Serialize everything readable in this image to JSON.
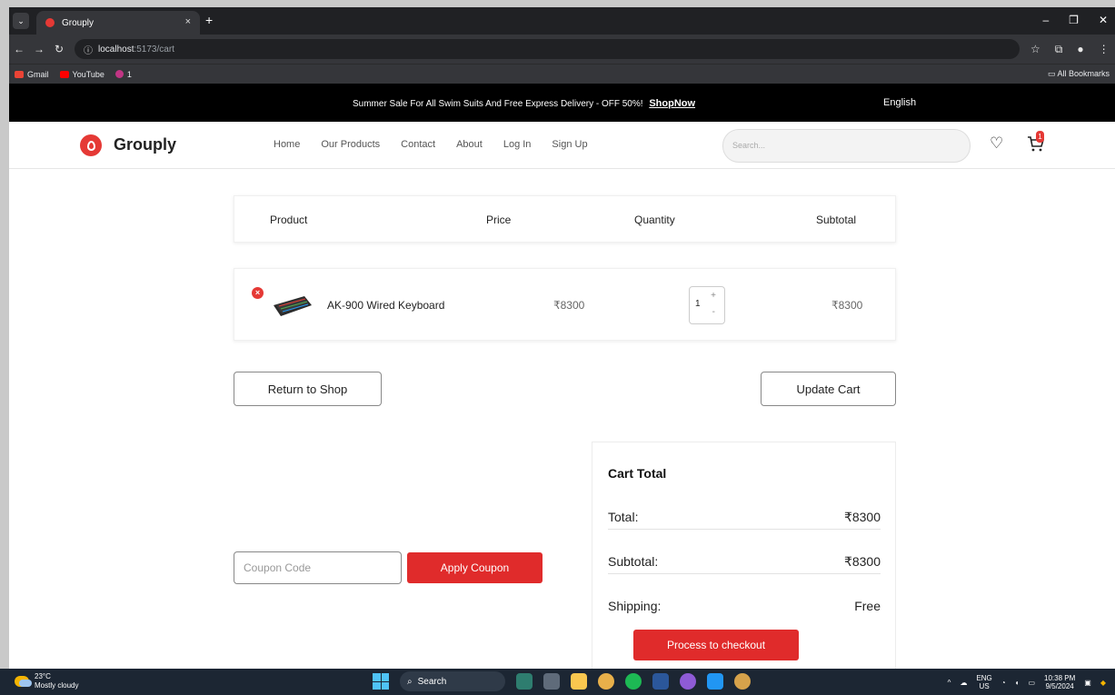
{
  "browser": {
    "tab_title": "Grouply",
    "tab_close": "×",
    "new_tab": "+",
    "url_host": "localhost",
    "url_path": ":5173/cart",
    "bookmarks": [
      {
        "label": "Gmail",
        "color": "#ea4335"
      },
      {
        "label": "YouTube",
        "color": "#ff0000"
      },
      {
        "label": "1",
        "color": "#c13584"
      }
    ],
    "all_bookmarks": "All Bookmarks"
  },
  "promo": {
    "text": "Summer Sale For All Swim Suits And Free Express Delivery - OFF 50%!",
    "link": "ShopNow",
    "language": "English"
  },
  "header": {
    "logo": "Grouply",
    "nav": [
      "Home",
      "Our Products",
      "Contact",
      "About",
      "Log In",
      "Sign Up"
    ],
    "search_placeholder": "Search...",
    "cart_count": "1"
  },
  "cart": {
    "columns": [
      "Product",
      "Price",
      "Quantity",
      "Subtotal"
    ],
    "items": [
      {
        "name": "AK-900 Wired Keyboard",
        "price": "₹8300",
        "quantity": "1",
        "subtotal": "₹8300"
      }
    ],
    "return_label": "Return to Shop",
    "update_label": "Update Cart"
  },
  "coupon": {
    "placeholder": "Coupon Code",
    "apply_label": "Apply Coupon"
  },
  "totals": {
    "title": "Cart Total",
    "rows": [
      {
        "label": "Total:",
        "value": "₹8300"
      },
      {
        "label": "Subtotal:",
        "value": "₹8300"
      },
      {
        "label": "Shipping:",
        "value": "Free"
      }
    ],
    "checkout_label": "Process to checkout"
  },
  "taskbar": {
    "temp": "23°C",
    "weather": "Mostly cloudy",
    "search": "Search",
    "lang1": "ENG",
    "lang2": "US",
    "time": "10:38 PM",
    "date": "9/5/2024"
  },
  "colors": {
    "accent": "#e02b2b",
    "promo_bg": "#000000"
  }
}
